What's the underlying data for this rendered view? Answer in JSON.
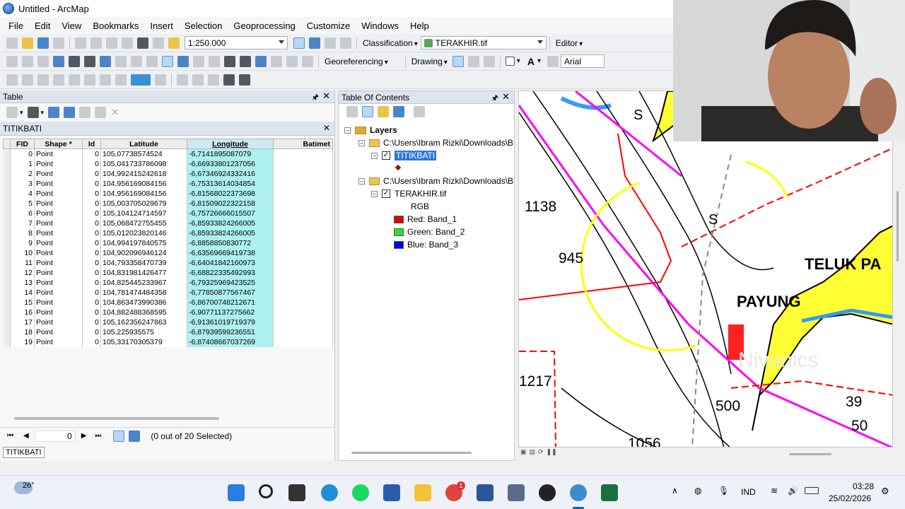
{
  "window": {
    "title": "Untitled - ArcMap"
  },
  "menu": [
    "File",
    "Edit",
    "View",
    "Bookmarks",
    "Insert",
    "Selection",
    "Geoprocessing",
    "Customize",
    "Windows",
    "Help"
  ],
  "toolbar": {
    "scale": "1:250.000",
    "classification": "Classification",
    "layer_combo": "TERAKHIR.tif",
    "editor": "Editor",
    "georeferencing": "Georeferencing",
    "drawing": "Drawing",
    "font": "Arial"
  },
  "table_panel": {
    "title": "Table",
    "tab": "TITIKBATI",
    "footer_record": "0",
    "footer_selected": "(0 out of 20 Selected)",
    "bottom_tab": "TITIKBATI"
  },
  "table": {
    "columns": [
      "FID",
      "Shape *",
      "Id",
      "Latitude",
      "Longitude",
      "Batimet"
    ],
    "rows": [
      [
        "0",
        "Point",
        "0",
        "105,07738574524",
        "-6,7141895087079"
      ],
      [
        "1",
        "Point",
        "0",
        "105,041733786098",
        "-6,66933801237056"
      ],
      [
        "2",
        "Point",
        "0",
        "104,992415242618",
        "-6,67346924332416"
      ],
      [
        "3",
        "Point",
        "0",
        "104,956169084156",
        "-6,75313614034854"
      ],
      [
        "4",
        "Point",
        "0",
        "104,956169084156",
        "-6,81568022373698"
      ],
      [
        "5",
        "Point",
        "0",
        "105,003705029679",
        "-6,81509022322158"
      ],
      [
        "6",
        "Point",
        "0",
        "105,104124714597",
        "-6,75726666015507"
      ],
      [
        "7",
        "Point",
        "0",
        "105,068472755455",
        "-6,85933824266005"
      ],
      [
        "8",
        "Point",
        "0",
        "105,012023820146",
        "-6,85933824266005"
      ],
      [
        "9",
        "Point",
        "0",
        "104,994197840575",
        "-6,8858850830772"
      ],
      [
        "10",
        "Point",
        "0",
        "104,902096946124",
        "-6,63569669419738"
      ],
      [
        "11",
        "Point",
        "0",
        "104,793358470739",
        "-6,64041842160973"
      ],
      [
        "12",
        "Point",
        "0",
        "104,831981426477",
        "-6,68822335492993"
      ],
      [
        "13",
        "Point",
        "0",
        "104,825445233967",
        "-6,79325969423525"
      ],
      [
        "14",
        "Point",
        "0",
        "104,781474484358",
        "-6,77850877567467"
      ],
      [
        "15",
        "Point",
        "0",
        "104,863473990386",
        "-6,86700748212671"
      ],
      [
        "16",
        "Point",
        "0",
        "104,882488368595",
        "-6,90771137275662"
      ],
      [
        "17",
        "Point",
        "0",
        "105,162356247863",
        "-6,91361019719379"
      ],
      [
        "18",
        "Point",
        "0",
        "105,225935575",
        "-6,87939599236551"
      ],
      [
        "19",
        "Point",
        "0",
        "105,33170305379",
        "-6,87408667037269"
      ]
    ]
  },
  "toc": {
    "title": "Table Of Contents",
    "layers_label": "Layers",
    "group1_path": "C:\\Users\\Ibram Rizki\\Downloads\\B",
    "layer1": "TITIKBATI",
    "group2_path": "C:\\Users\\Ibram Rizki\\Downloads\\B",
    "layer2": "TERAKHIR.tif",
    "rgb": "RGB",
    "red": "Red:   Band_1",
    "green": "Green: Band_2",
    "blue": "Blue:   Band_3",
    "colors": {
      "red": "#e00000",
      "green": "#33dd33",
      "blue": "#0000ee"
    }
  },
  "map": {
    "labels": [
      "1138",
      "945",
      "1217",
      "500",
      "1056",
      "39",
      "50",
      "TELUK PA",
      "PAYUNG",
      "S",
      "S",
      "Nivonics"
    ],
    "colors": {
      "land": "#ffff33",
      "coast": "#3399ff",
      "boundary": "#ff0000",
      "route": "#ff00ff"
    }
  },
  "taskbar": {
    "temperature": "26°",
    "language": "IND",
    "time": "03:28",
    "date": "25/02/2026",
    "badge": "1"
  }
}
